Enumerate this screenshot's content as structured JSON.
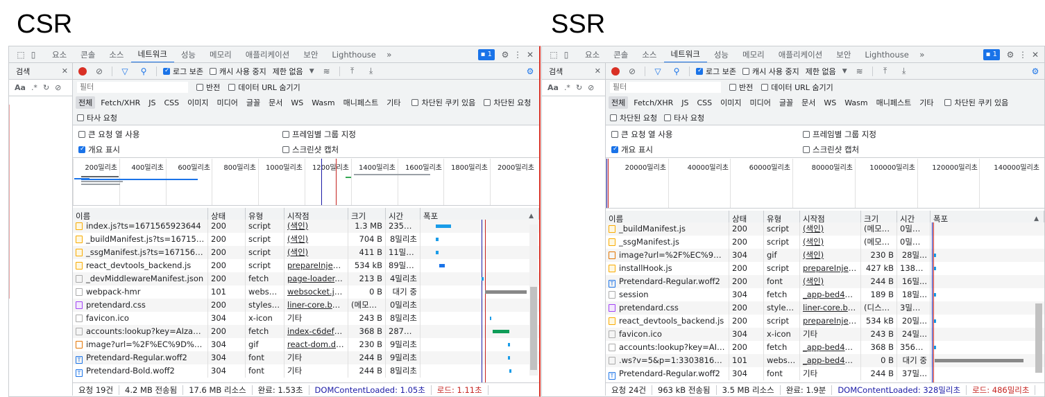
{
  "labels": {
    "csr": "CSR",
    "ssr": "SSR"
  },
  "tabs": [
    "요소",
    "콘솔",
    "소스",
    "네트워크",
    "성능",
    "메모리",
    "애플리케이션",
    "보안",
    "Lighthouse"
  ],
  "active_tab": "네트워크",
  "more": "»",
  "badge": "1",
  "search_title": "검색",
  "search_opts": [
    "Aa",
    ".*"
  ],
  "toolbar": {
    "preserve_log": "로그 보존",
    "disable_cache": "캐시 사용 중지",
    "throttle": "제한 없음"
  },
  "filter_placeholder": "필터",
  "invert": "반전",
  "hide_data_urls": "데이터 URL 숨기기",
  "types": [
    "전체",
    "Fetch/XHR",
    "JS",
    "CSS",
    "이미지",
    "미디어",
    "글꼴",
    "문서",
    "WS",
    "Wasm",
    "매니페스트",
    "기타"
  ],
  "blocked_cookies": "차단된 쿠키 있음",
  "blocked_requests": "차단된 요청",
  "third_party": "타사 요청",
  "options": {
    "big_rows": "큰 요청 열 사용",
    "group_frame": "프레임별 그룹 지정",
    "overview": "개요 표시",
    "screenshots": "스크린샷 캡처"
  },
  "columns": [
    "이름",
    "상태",
    "유형",
    "시작점",
    "크기",
    "시간",
    "폭포"
  ],
  "colors": {
    "accent": "#1a73e8",
    "record": "#d93025",
    "dcl": "#1a1aa6",
    "load": "#c5221f"
  },
  "csr": {
    "ticks": [
      "200밀리초",
      "400밀리초",
      "600밀리초",
      "800밀리초",
      "1000밀리초",
      "1200밀리초",
      "1400밀리초",
      "1600밀리초",
      "1800밀리초",
      "2000밀리초"
    ],
    "rows": [
      [
        "index.js?ts=1671565923644",
        "200",
        "script",
        "(색인)",
        "1.3 MB",
        "235밀...",
        "script"
      ],
      [
        "_buildManifest.js?ts=167156592...",
        "200",
        "script",
        "(색인)",
        "704 B",
        "8밀리초",
        "script"
      ],
      [
        "_ssgManifest.js?ts=1671565925...",
        "200",
        "script",
        "(색인)",
        "411 B",
        "11밀리...",
        "script"
      ],
      [
        "react_devtools_backend.js",
        "200",
        "script",
        "prepareInjectio...",
        "534 kB",
        "89밀리...",
        "script"
      ],
      [
        "_devMiddlewareManifest.json",
        "200",
        "fetch",
        "page-loader.js?...",
        "213 B",
        "4밀리초",
        "doc"
      ],
      [
        "webpack-hmr",
        "101",
        "websoc...",
        "websocket.js?a...",
        "0 B",
        "대기 중",
        "doc"
      ],
      [
        "pretendard.css",
        "200",
        "styleshe...",
        "liner-core.be.js:...",
        "(메모리...",
        "0밀리초",
        "css"
      ],
      [
        "favicon.ico",
        "304",
        "x-icon",
        "기타",
        "243 B",
        "8밀리초",
        "doc"
      ],
      [
        "accounts:lookup?key=AIzaSyAfx...",
        "200",
        "fetch",
        "index-c6def6da...",
        "368 B",
        "287밀...",
        "doc"
      ],
      [
        "image?url=%2F%EC%9D%B4%E...",
        "304",
        "gif",
        "react-dom.deve...",
        "230 B",
        "9밀리초",
        "img"
      ],
      [
        "Pretendard-Regular.woff2",
        "304",
        "font",
        "기타",
        "244 B",
        "9밀리초",
        "font"
      ],
      [
        "Pretendard-Bold.woff2",
        "304",
        "font",
        "기타",
        "244 B",
        "8밀리초",
        "font"
      ]
    ],
    "status": {
      "requests": "요청 19건",
      "transferred": "4.2 MB 전송됨",
      "resources": "17.6 MB 리소스",
      "finish": "완료: 1.53초",
      "dcl": "DOMContentLoaded: 1.05초",
      "load": "로드: 1.11초"
    }
  },
  "ssr": {
    "ticks": [
      "20000밀리초",
      "40000밀리초",
      "60000밀리초",
      "80000밀리초",
      "100000밀리초",
      "120000밀리초",
      "140000밀리초"
    ],
    "rows": [
      [
        "_buildManifest.js",
        "200",
        "script",
        "(색인)",
        "(메모리...",
        "0밀리초",
        "script"
      ],
      [
        "_ssgManifest.js",
        "200",
        "script",
        "(색인)",
        "(메모리...",
        "0밀리초",
        "script"
      ],
      [
        "image?url=%2F%EC%9D%B4...",
        "304",
        "gif",
        "(색인)",
        "230 B",
        "28밀...",
        "img"
      ],
      [
        "installHook.js",
        "200",
        "script",
        "prepareInjecti...",
        "427 kB",
        "138밀...",
        "script"
      ],
      [
        "Pretendard-Regular.woff2",
        "200",
        "font",
        "(색인)",
        "244 B",
        "16밀...",
        "font"
      ],
      [
        "session",
        "304",
        "fetch",
        "_app-bed46e4...",
        "189 B",
        "18밀...",
        "doc"
      ],
      [
        "pretendard.css",
        "200",
        "stylesh...",
        "liner-core.be.js...",
        "(디스크...",
        "3밀리초",
        "css"
      ],
      [
        "react_devtools_backend.js",
        "200",
        "script",
        "prepareInjecti...",
        "534 kB",
        "20밀...",
        "script"
      ],
      [
        "favicon.ico",
        "304",
        "x-icon",
        "기타",
        "243 B",
        "24밀...",
        "doc"
      ],
      [
        "accounts:lookup?key=AIzaSyA...",
        "200",
        "fetch",
        "_app-bed46e4...",
        "368 B",
        "356밀...",
        "doc"
      ],
      [
        ".ws?v=5&p=1:330381651629:...",
        "101",
        "websoc...",
        "_app-bed46e4...",
        "0 B",
        "대기 중",
        "doc"
      ],
      [
        "Pretendard-Regular.woff2",
        "304",
        "font",
        "기타",
        "244 B",
        "37밀...",
        "font"
      ]
    ],
    "status": {
      "requests": "요청 24건",
      "transferred": "963 kB 전송됨",
      "resources": "3.5 MB 리소스",
      "finish": "완료: 1.9분",
      "dcl": "DOMContentLoaded: 328밀리초",
      "load": "로드: 486밀리초"
    }
  }
}
